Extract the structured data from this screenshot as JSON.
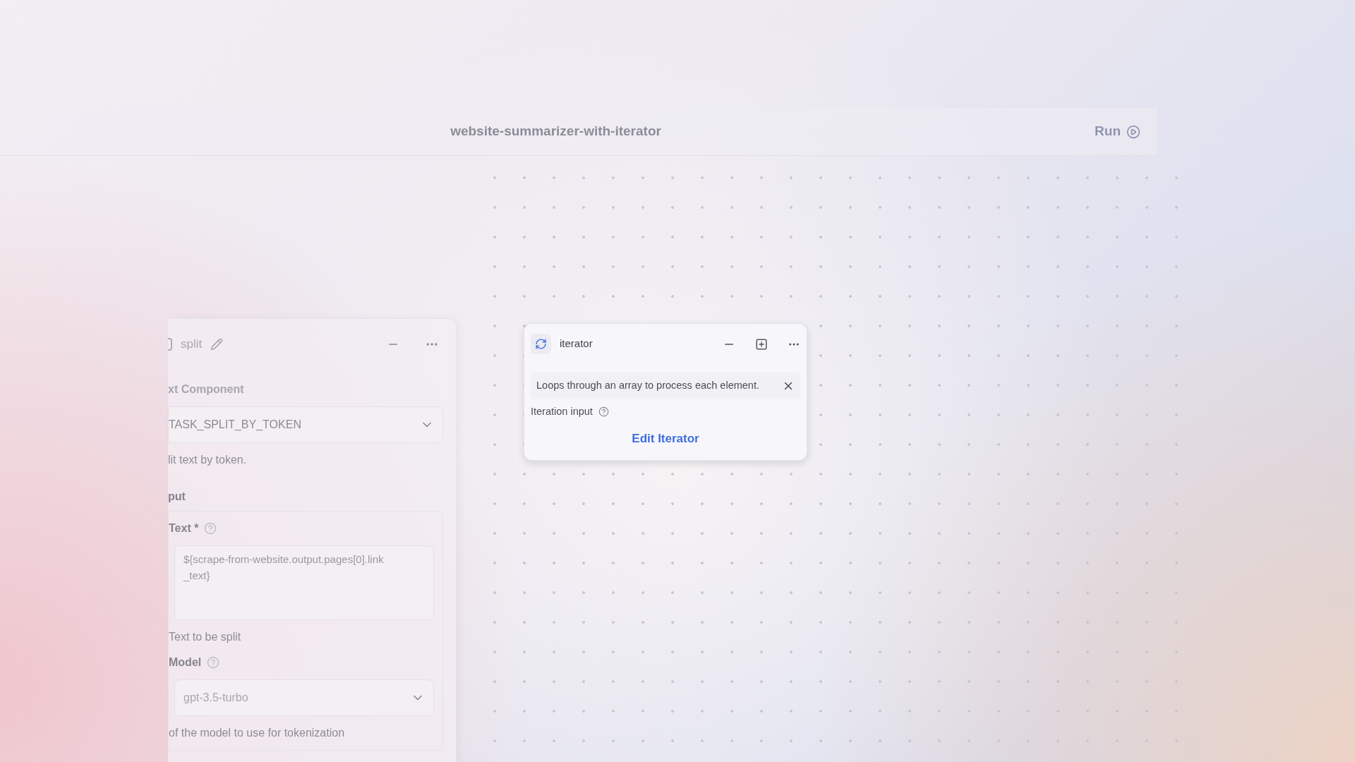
{
  "header": {
    "title": "website-summarizer-with-iterator",
    "run_button": "Run"
  },
  "split_node": {
    "title": "split",
    "section": "xt Component",
    "task": "TASK_SPLIT_BY_TOKEN",
    "task_description": "lit text by token.",
    "input_heading": "put",
    "fields": [
      {
        "kind": "textarea",
        "label": "Text *",
        "value": "${scrape-from-website.output.pages[0].link_text}",
        "hint": "Text to be split"
      },
      {
        "kind": "select",
        "label": "Model",
        "value": "gpt-3.5-turbo",
        "hint": "of the model to use for tokenization"
      }
    ]
  },
  "iterator_node": {
    "title": "iterator",
    "description": "Loops through an array to process each element.",
    "input_label": "Iteration input",
    "edit_button": "Edit Iterator"
  }
}
